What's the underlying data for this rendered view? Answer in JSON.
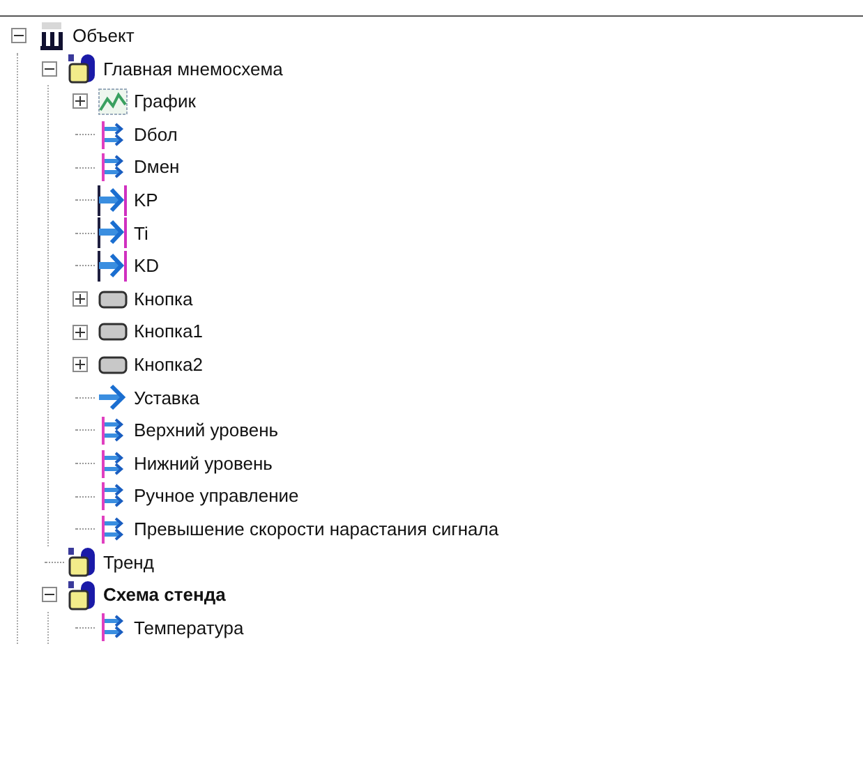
{
  "tree": [
    {
      "label": "Объект",
      "kind": "object",
      "expanded": true,
      "selected": false,
      "children": [
        {
          "label": "Главная мнемосхема",
          "kind": "screen",
          "expanded": true,
          "selected": false,
          "children": [
            {
              "label": "График",
              "kind": "chart",
              "expanded": false,
              "selected": false
            },
            {
              "label": "Dбол",
              "kind": "signal",
              "selected": false
            },
            {
              "label": "Dмен",
              "kind": "signal",
              "selected": false
            },
            {
              "label": "KP",
              "kind": "param",
              "selected": false
            },
            {
              "label": "Ti",
              "kind": "param",
              "selected": false
            },
            {
              "label": "KD",
              "kind": "param",
              "selected": false
            },
            {
              "label": "Кнопка",
              "kind": "button",
              "expanded": false,
              "selected": false
            },
            {
              "label": "Кнопка1",
              "kind": "button",
              "expanded": false,
              "selected": false
            },
            {
              "label": "Кнопка2",
              "kind": "button",
              "expanded": false,
              "selected": false
            },
            {
              "label": "Уставка",
              "kind": "setpoint",
              "selected": false
            },
            {
              "label": "Верхний уровень",
              "kind": "signal",
              "selected": false
            },
            {
              "label": "Нижний уровень",
              "kind": "signal",
              "selected": false
            },
            {
              "label": "Ручное управление",
              "kind": "signal",
              "selected": false
            },
            {
              "label": "Превышение скорости нарастания сигнала",
              "kind": "signal",
              "selected": false
            }
          ]
        },
        {
          "label": "Тренд",
          "kind": "screen",
          "selected": false
        },
        {
          "label": "Схема стенда",
          "kind": "screen",
          "expanded": true,
          "selected": true,
          "children": [
            {
              "label": "Температура",
              "kind": "signal",
              "selected": false
            }
          ]
        }
      ]
    }
  ]
}
